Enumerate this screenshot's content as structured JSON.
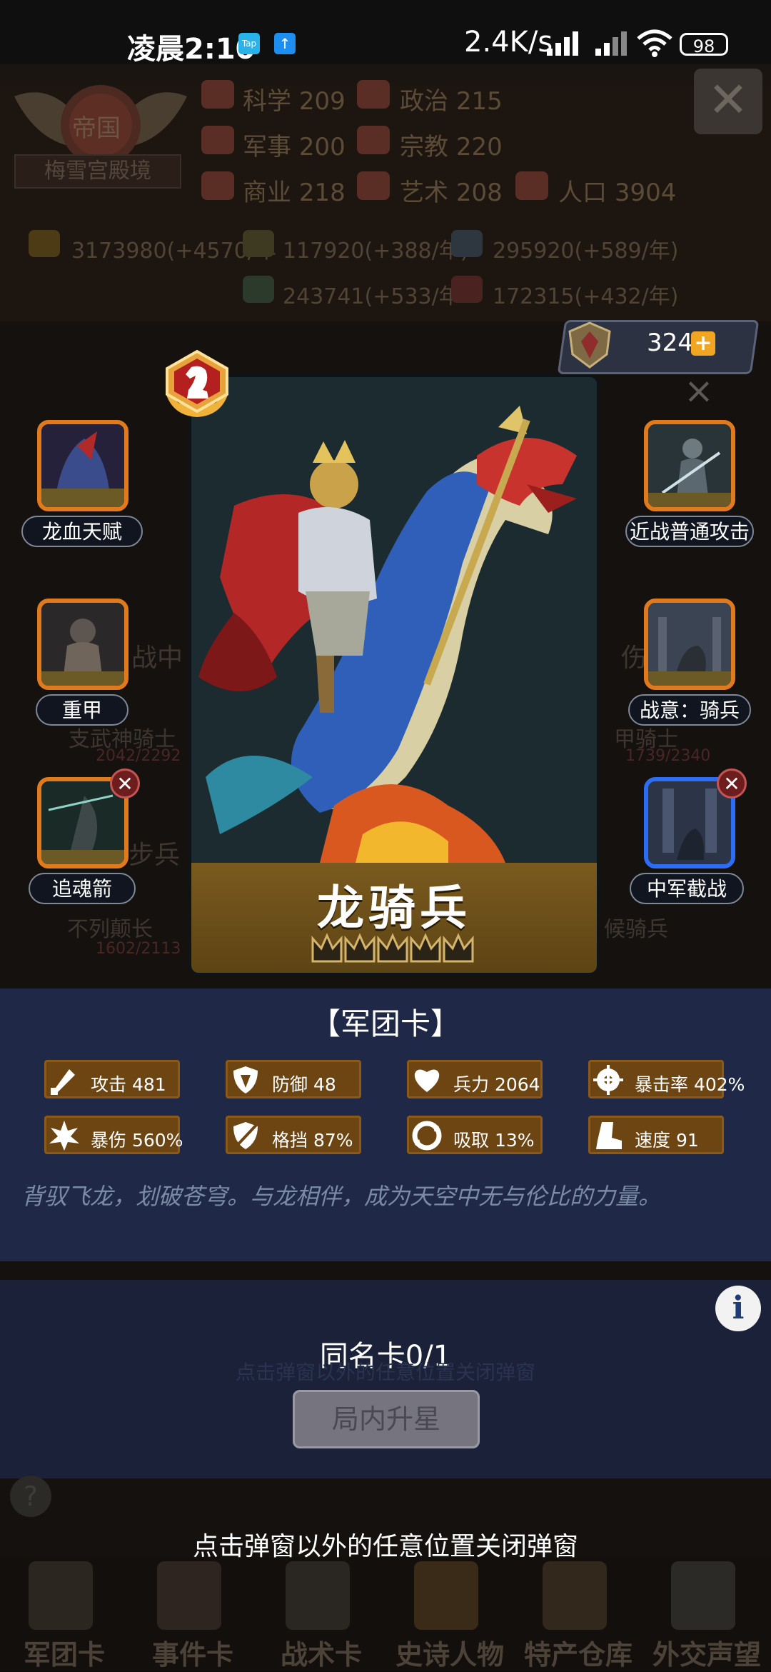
{
  "status_bar": {
    "time": "凌晨2:10",
    "app_icon_1": "Tap",
    "app_icon_2": "↑",
    "speed": "2.4K/s",
    "battery": "98"
  },
  "background": {
    "emblem_title": "帝国",
    "emblem_label": "梅雪宫殿境",
    "stats": [
      {
        "icon": "science-icon",
        "label": "科学",
        "value": "209"
      },
      {
        "icon": "politics-icon",
        "label": "政治",
        "value": "215"
      },
      {
        "icon": "military-icon",
        "label": "军事",
        "value": "200"
      },
      {
        "icon": "religion-icon",
        "label": "宗教",
        "value": "220"
      },
      {
        "icon": "commerce-icon",
        "label": "商业",
        "value": "218"
      },
      {
        "icon": "art-icon",
        "label": "艺术",
        "value": "208"
      },
      {
        "icon": "population-icon",
        "label": "人口",
        "value": "3904"
      }
    ],
    "resources": [
      "3173980(+4570/年",
      "117920(+388/年)",
      "295920(+589/年)",
      "243741(+533/年",
      "172315(+432/年)"
    ],
    "ghost_texts": [
      "战中",
      "步兵",
      "伤兵",
      "支武神骑士",
      "甲骑士",
      "2042/2292",
      "1739/2340",
      "不列颠长",
      "1602/2113",
      "候骑兵"
    ]
  },
  "counter": {
    "value": "324",
    "plus": "+"
  },
  "card": {
    "name": "龙骑兵",
    "stars": 5,
    "badge_icon": "knight-chess-icon",
    "close_symbol": "×"
  },
  "skills_left": [
    {
      "label": "龙血天赋",
      "removable": false
    },
    {
      "label": "重甲",
      "removable": false
    },
    {
      "label": "追魂箭",
      "removable": true
    }
  ],
  "skills_right": [
    {
      "label": "近战普通攻击",
      "removable": false
    },
    {
      "label": "战意：骑兵",
      "removable": false
    },
    {
      "label": "中军截战",
      "removable": true
    }
  ],
  "stats_panel": {
    "title": "【军团卡】",
    "stats": [
      {
        "icon": "sword-icon",
        "text": "攻击 481"
      },
      {
        "icon": "shield-icon",
        "text": "防御 48"
      },
      {
        "icon": "heart-icon",
        "text": "兵力 2064"
      },
      {
        "icon": "crosshair-icon",
        "text": "暴击率 402%"
      },
      {
        "icon": "burst-icon",
        "text": "暴伤 560%"
      },
      {
        "icon": "parry-icon",
        "text": "格挡 87%"
      },
      {
        "icon": "absorb-icon",
        "text": "吸取 13%"
      },
      {
        "icon": "boot-icon",
        "text": "速度 91"
      }
    ],
    "description": "背驭飞龙，划破苍穹。与龙相伴，成为天空中无与伦比的力量。"
  },
  "bottom": {
    "info": "i",
    "same_card": "同名卡0/1",
    "upgrade_button": "局内升星",
    "close_hint": "点击弹窗以外的任意位置关闭弹窗",
    "faded_hint": "点击弹窗以外的任意位置关闭弹窗"
  },
  "tabs": [
    {
      "label": "军团卡",
      "icon": "helmet-icon"
    },
    {
      "label": "事件卡",
      "icon": "event-icon"
    },
    {
      "label": "战术卡",
      "icon": "tactics-icon"
    },
    {
      "label": "史诗人物",
      "icon": "crown-icon"
    },
    {
      "label": "特产仓库",
      "icon": "warehouse-icon"
    },
    {
      "label": "外交声望",
      "icon": "letter-icon"
    }
  ],
  "colors": {
    "accent_orange": "#e07a1c",
    "accent_blue": "#2d6cf5",
    "panel_blue": "#1f2947",
    "stat_brown": "#6d4512"
  }
}
